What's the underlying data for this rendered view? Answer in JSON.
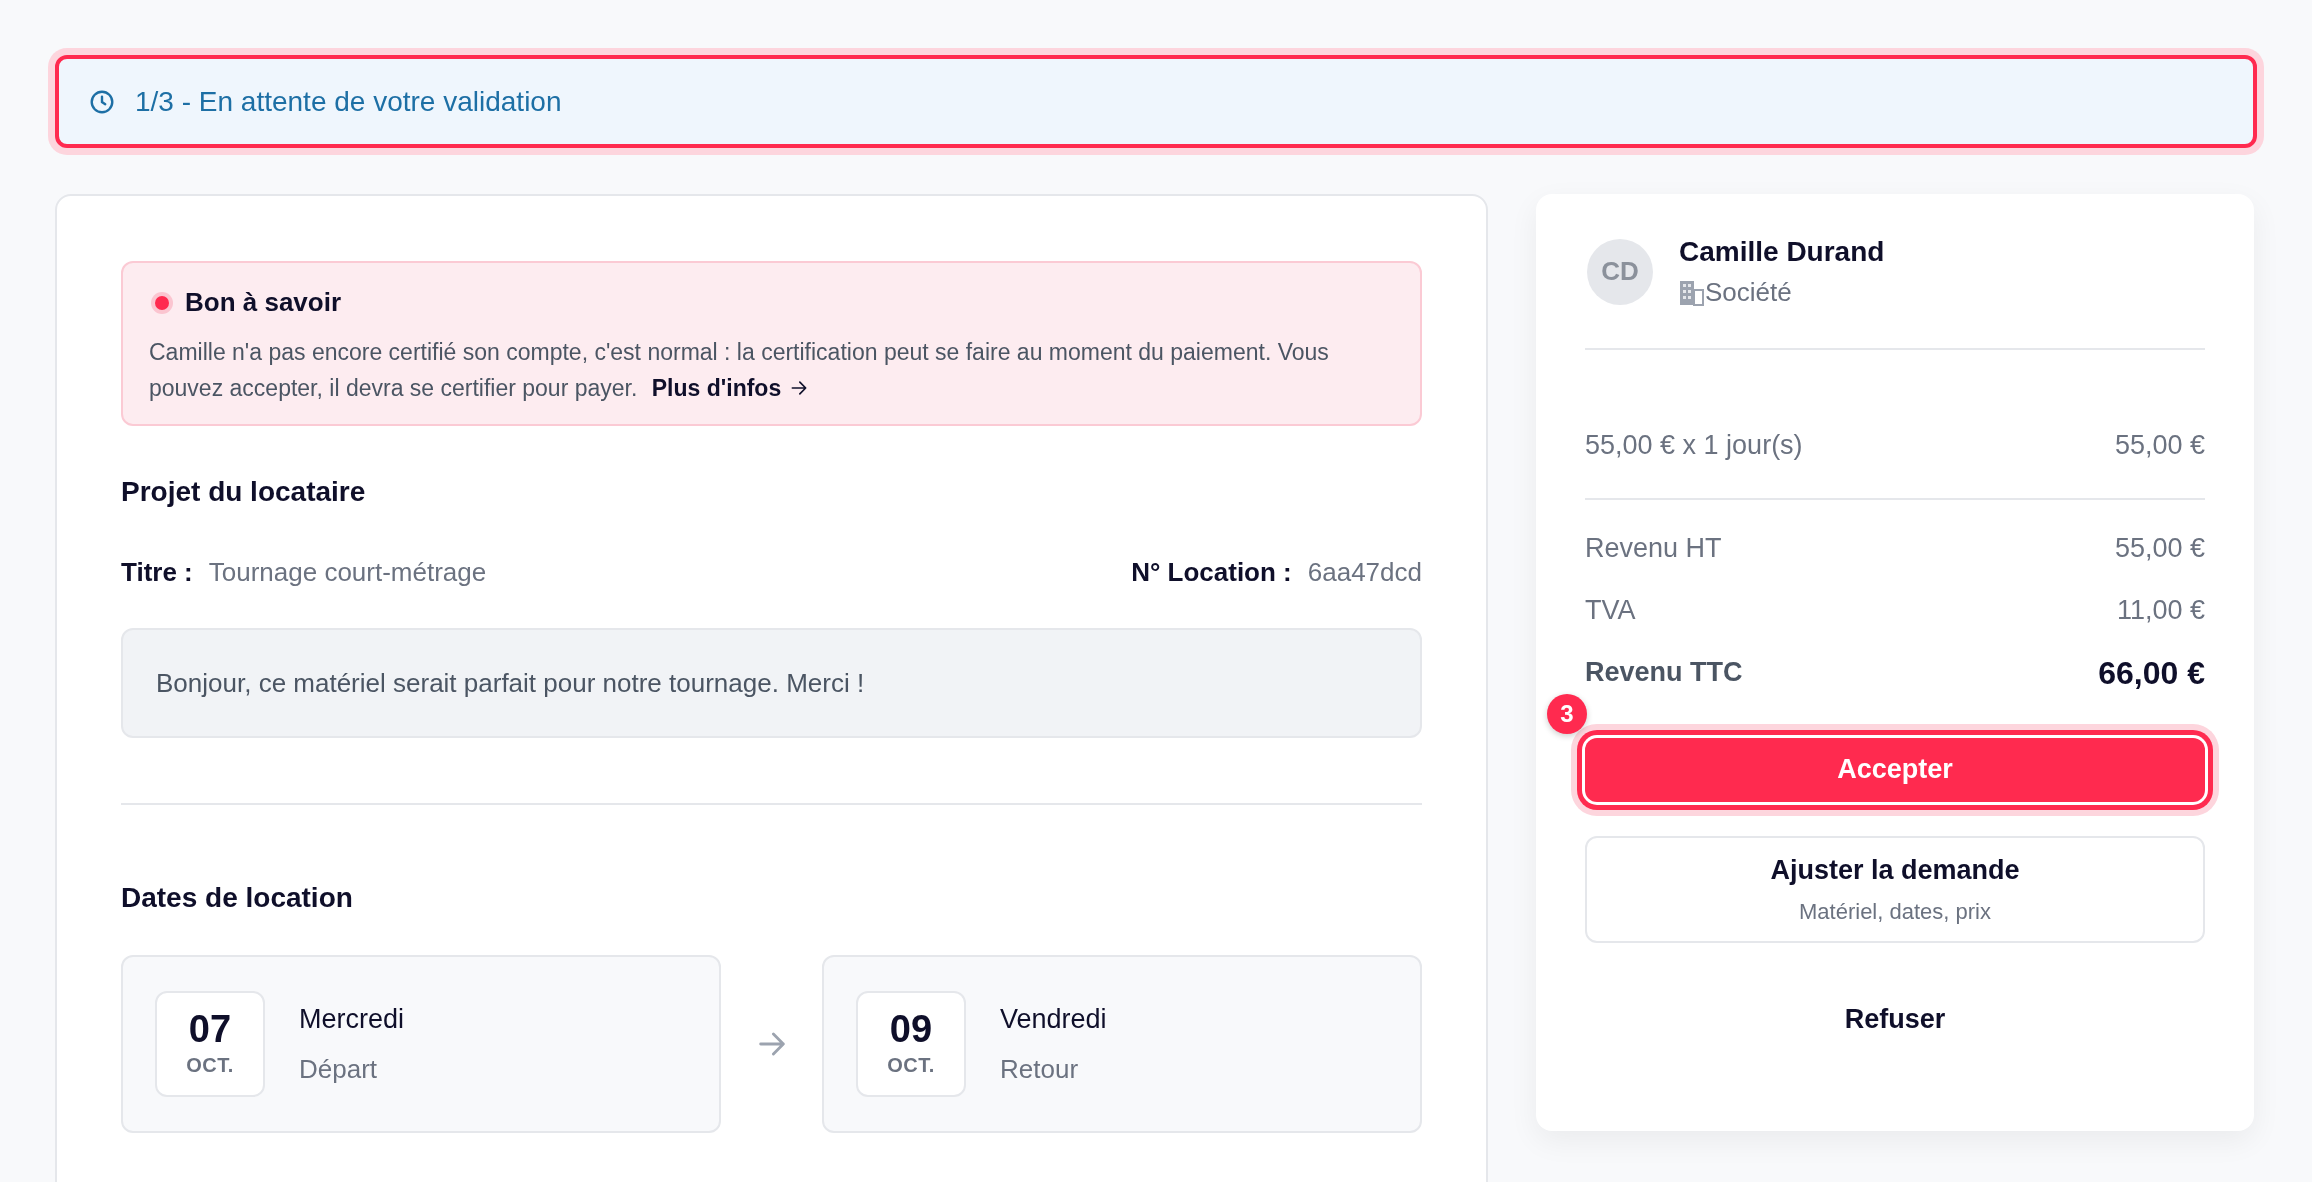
{
  "status_banner": {
    "text": "1/3 - En attente de votre validation",
    "highlighted": true
  },
  "notice": {
    "title": "Bon à savoir",
    "text": "Camille n'a pas encore certifié son compte, c'est normal : la certification peut se faire au moment du paiement. Vous pouvez accepter, il devra se certifier pour payer.",
    "link": "Plus d'infos"
  },
  "project": {
    "heading": "Projet du locataire",
    "title_label": "Titre :",
    "title_value": "Tournage court-métrage",
    "location_label": "N° Location :",
    "location_value": "6aa47dcd",
    "message": "Bonjour, ce matériel serait parfait pour notre tournage. Merci !"
  },
  "dates": {
    "heading": "Dates de location",
    "items": [
      {
        "day": "07",
        "month": "OCT.",
        "weekday": "Mercredi",
        "role": "Départ"
      },
      {
        "day": "09",
        "month": "OCT.",
        "weekday": "Vendredi",
        "role": "Retour"
      }
    ]
  },
  "renter": {
    "initials": "CD",
    "name": "Camille Durand",
    "type": "Société"
  },
  "pricing": {
    "line": {
      "label": "55,00 € x 1 jour(s)",
      "value": "55,00 €"
    },
    "rows": [
      {
        "label": "Revenu HT",
        "value": "55,00 €",
        "kind": "normal"
      },
      {
        "label": "TVA",
        "value": "11,00 €",
        "kind": "normal"
      },
      {
        "label": "Revenu TTC",
        "value": "66,00 €",
        "kind": "total"
      }
    ]
  },
  "actions": [
    {
      "kind": "primary",
      "label": "Accepter",
      "highlighted": true,
      "step": "3"
    },
    {
      "kind": "secondary",
      "label": "Ajuster la demande",
      "sublabel": "Matériel, dates, prix"
    },
    {
      "kind": "plain",
      "label": "Refuser"
    }
  ]
}
